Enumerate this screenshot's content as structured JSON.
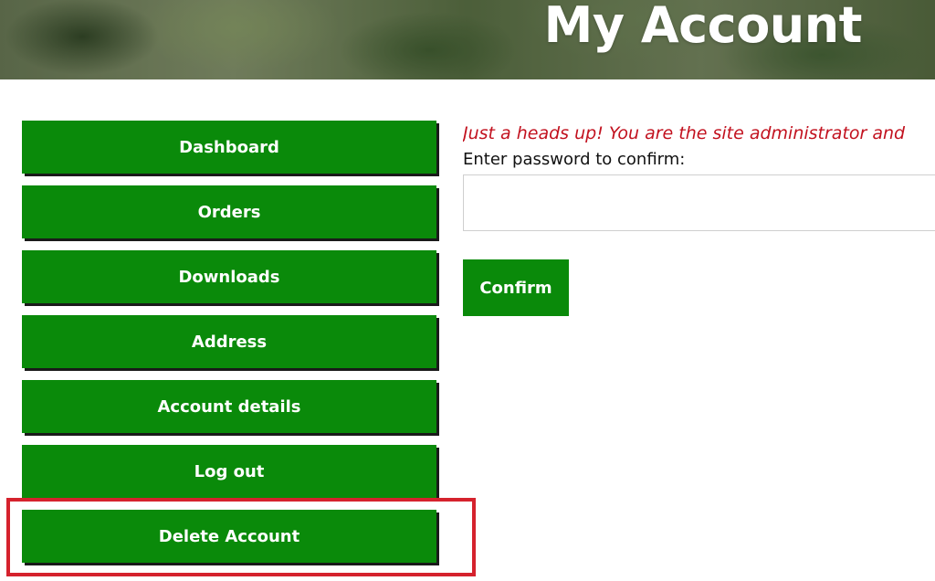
{
  "header": {
    "title": "My Account"
  },
  "nav": {
    "items": [
      {
        "label": "Dashboard"
      },
      {
        "label": "Orders"
      },
      {
        "label": "Downloads"
      },
      {
        "label": "Address"
      },
      {
        "label": "Account details"
      },
      {
        "label": "Log out"
      },
      {
        "label": "Delete Account"
      }
    ]
  },
  "main": {
    "notice": "Just a heads up! You are the site administrator and",
    "password_label": "Enter password to confirm:",
    "password_value": "",
    "confirm_label": "Confirm"
  },
  "colors": {
    "accent_green": "#0a8a0a",
    "notice_red": "#c2121f",
    "highlight_red": "#d5222d"
  }
}
